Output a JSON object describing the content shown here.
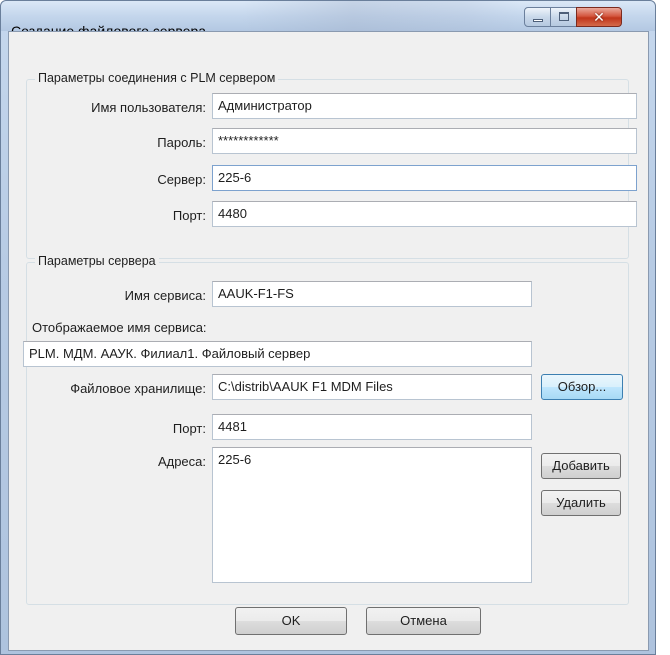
{
  "window": {
    "title": "Создание файлового сервера",
    "close_glyph": "✕"
  },
  "plm": {
    "group_title": "Параметры соединения с PLM сервером",
    "user_label": "Имя пользователя:",
    "user_value": "Администратор",
    "password_label": "Пароль:",
    "password_value": "************",
    "server_label": "Сервер:",
    "server_value": "225-6",
    "port_label": "Порт:",
    "port_value": "4480"
  },
  "server": {
    "group_title": "Параметры сервера",
    "service_name_label": "Имя сервиса:",
    "service_name_value": "AAUK-F1-FS",
    "display_name_label": "Отображаемое имя сервиса:",
    "display_name_value": "PLM. МДМ. ААУК. Филиал1. Файловый сервер",
    "storage_label": "Файловое хранилище:",
    "storage_value": "C:\\distrib\\AAUK F1 MDM Files",
    "browse_label": "Обзор...",
    "port_label": "Порт:",
    "port_value": "4481",
    "addresses_label": "Адреса:",
    "addresses_value": "225-6",
    "add_label": "Добавить",
    "remove_label": "Удалить"
  },
  "footer": {
    "ok_label": "OK",
    "cancel_label": "Отмена"
  },
  "icons": {
    "minimize": "minimize-icon",
    "maximize": "maximize-icon",
    "close": "close-icon"
  }
}
